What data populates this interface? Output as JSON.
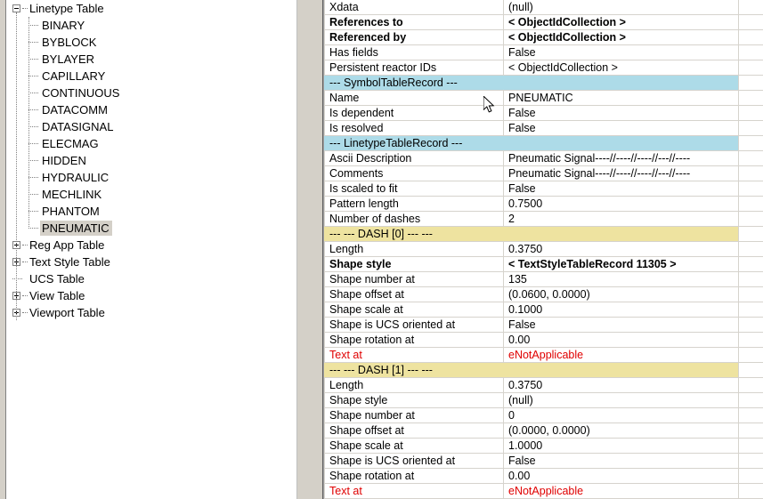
{
  "tree": {
    "items": [
      {
        "label": "Linetype Table",
        "depth": 0,
        "toggle": "minus",
        "selected": false
      },
      {
        "label": "BINARY",
        "depth": 1,
        "toggle": "leaf",
        "selected": false
      },
      {
        "label": "BYBLOCK",
        "depth": 1,
        "toggle": "leaf",
        "selected": false
      },
      {
        "label": "BYLAYER",
        "depth": 1,
        "toggle": "leaf",
        "selected": false
      },
      {
        "label": "CAPILLARY",
        "depth": 1,
        "toggle": "leaf",
        "selected": false
      },
      {
        "label": "CONTINUOUS",
        "depth": 1,
        "toggle": "leaf",
        "selected": false
      },
      {
        "label": "DATACOMM",
        "depth": 1,
        "toggle": "leaf",
        "selected": false
      },
      {
        "label": "DATASIGNAL",
        "depth": 1,
        "toggle": "leaf",
        "selected": false
      },
      {
        "label": "ELECMAG",
        "depth": 1,
        "toggle": "leaf",
        "selected": false
      },
      {
        "label": "HIDDEN",
        "depth": 1,
        "toggle": "leaf",
        "selected": false
      },
      {
        "label": "HYDRAULIC",
        "depth": 1,
        "toggle": "leaf",
        "selected": false
      },
      {
        "label": "MECHLINK",
        "depth": 1,
        "toggle": "leaf",
        "selected": false
      },
      {
        "label": "PHANTOM",
        "depth": 1,
        "toggle": "leaf",
        "selected": false
      },
      {
        "label": "PNEUMATIC",
        "depth": 1,
        "toggle": "leaf",
        "selected": true
      },
      {
        "label": "Reg App Table",
        "depth": 0,
        "toggle": "plus",
        "selected": false
      },
      {
        "label": "Text Style Table",
        "depth": 0,
        "toggle": "plus",
        "selected": false
      },
      {
        "label": "UCS Table",
        "depth": 0,
        "toggle": "leaf0",
        "selected": false
      },
      {
        "label": "View Table",
        "depth": 0,
        "toggle": "plus",
        "selected": false
      },
      {
        "label": "Viewport Table",
        "depth": 0,
        "toggle": "plus",
        "selected": false
      }
    ]
  },
  "grid": {
    "rows": [
      {
        "name": "Xdata",
        "value": "(null)",
        "style": "normal"
      },
      {
        "name": "References to",
        "value": "< ObjectIdCollection >",
        "style": "bold"
      },
      {
        "name": "Referenced by",
        "value": "< ObjectIdCollection >",
        "style": "bold"
      },
      {
        "name": "Has fields",
        "value": "False",
        "style": "normal"
      },
      {
        "name": "Persistent reactor IDs",
        "value": "< ObjectIdCollection >",
        "style": "normal"
      },
      {
        "name": "--- SymbolTableRecord ---",
        "value": "",
        "style": "header-blue"
      },
      {
        "name": "Name",
        "value": "PNEUMATIC",
        "style": "normal"
      },
      {
        "name": "Is dependent",
        "value": "False",
        "style": "normal"
      },
      {
        "name": "Is resolved",
        "value": "False",
        "style": "normal"
      },
      {
        "name": "--- LinetypeTableRecord ---",
        "value": "",
        "style": "header-blue"
      },
      {
        "name": "Ascii Description",
        "value": "Pneumatic Signal----//----//----//---//----",
        "style": "normal"
      },
      {
        "name": "Comments",
        "value": "Pneumatic Signal----//----//----//---//----",
        "style": "normal"
      },
      {
        "name": "Is scaled to fit",
        "value": "False",
        "style": "normal"
      },
      {
        "name": "Pattern length",
        "value": "0.7500",
        "style": "normal"
      },
      {
        "name": "Number of dashes",
        "value": "2",
        "style": "normal"
      },
      {
        "name": "--- --- DASH [0] --- ---",
        "value": "",
        "style": "header-yellow"
      },
      {
        "name": "Length",
        "value": "0.3750",
        "style": "normal"
      },
      {
        "name": "Shape style",
        "value": "< TextStyleTableRecord 11305 >",
        "style": "bold"
      },
      {
        "name": "Shape number at",
        "value": "135",
        "style": "normal"
      },
      {
        "name": "Shape offset at",
        "value": "(0.0600, 0.0000)",
        "style": "normal"
      },
      {
        "name": "Shape scale at",
        "value": "0.1000",
        "style": "normal"
      },
      {
        "name": "Shape is UCS oriented at",
        "value": "False",
        "style": "normal"
      },
      {
        "name": "Shape rotation at",
        "value": "0.00",
        "style": "normal"
      },
      {
        "name": "Text at",
        "value": "eNotApplicable",
        "style": "red"
      },
      {
        "name": "--- --- DASH [1] --- ---",
        "value": "",
        "style": "header-yellow"
      },
      {
        "name": "Length",
        "value": "0.3750",
        "style": "normal"
      },
      {
        "name": "Shape style",
        "value": "(null)",
        "style": "normal"
      },
      {
        "name": "Shape number at",
        "value": "0",
        "style": "normal"
      },
      {
        "name": "Shape offset at",
        "value": "(0.0000, 0.0000)",
        "style": "normal"
      },
      {
        "name": "Shape scale at",
        "value": "1.0000",
        "style": "normal"
      },
      {
        "name": "Shape is UCS oriented at",
        "value": "False",
        "style": "normal"
      },
      {
        "name": "Shape rotation at",
        "value": "0.00",
        "style": "normal"
      },
      {
        "name": "Text at",
        "value": "eNotApplicable",
        "style": "red"
      }
    ]
  },
  "colors": {
    "section_blue": "#addbe8",
    "section_yellow": "#eee3a0",
    "selection_gray": "#d4d0c8",
    "red_text": "#e00000",
    "grid_line": "#d6d3cd"
  }
}
